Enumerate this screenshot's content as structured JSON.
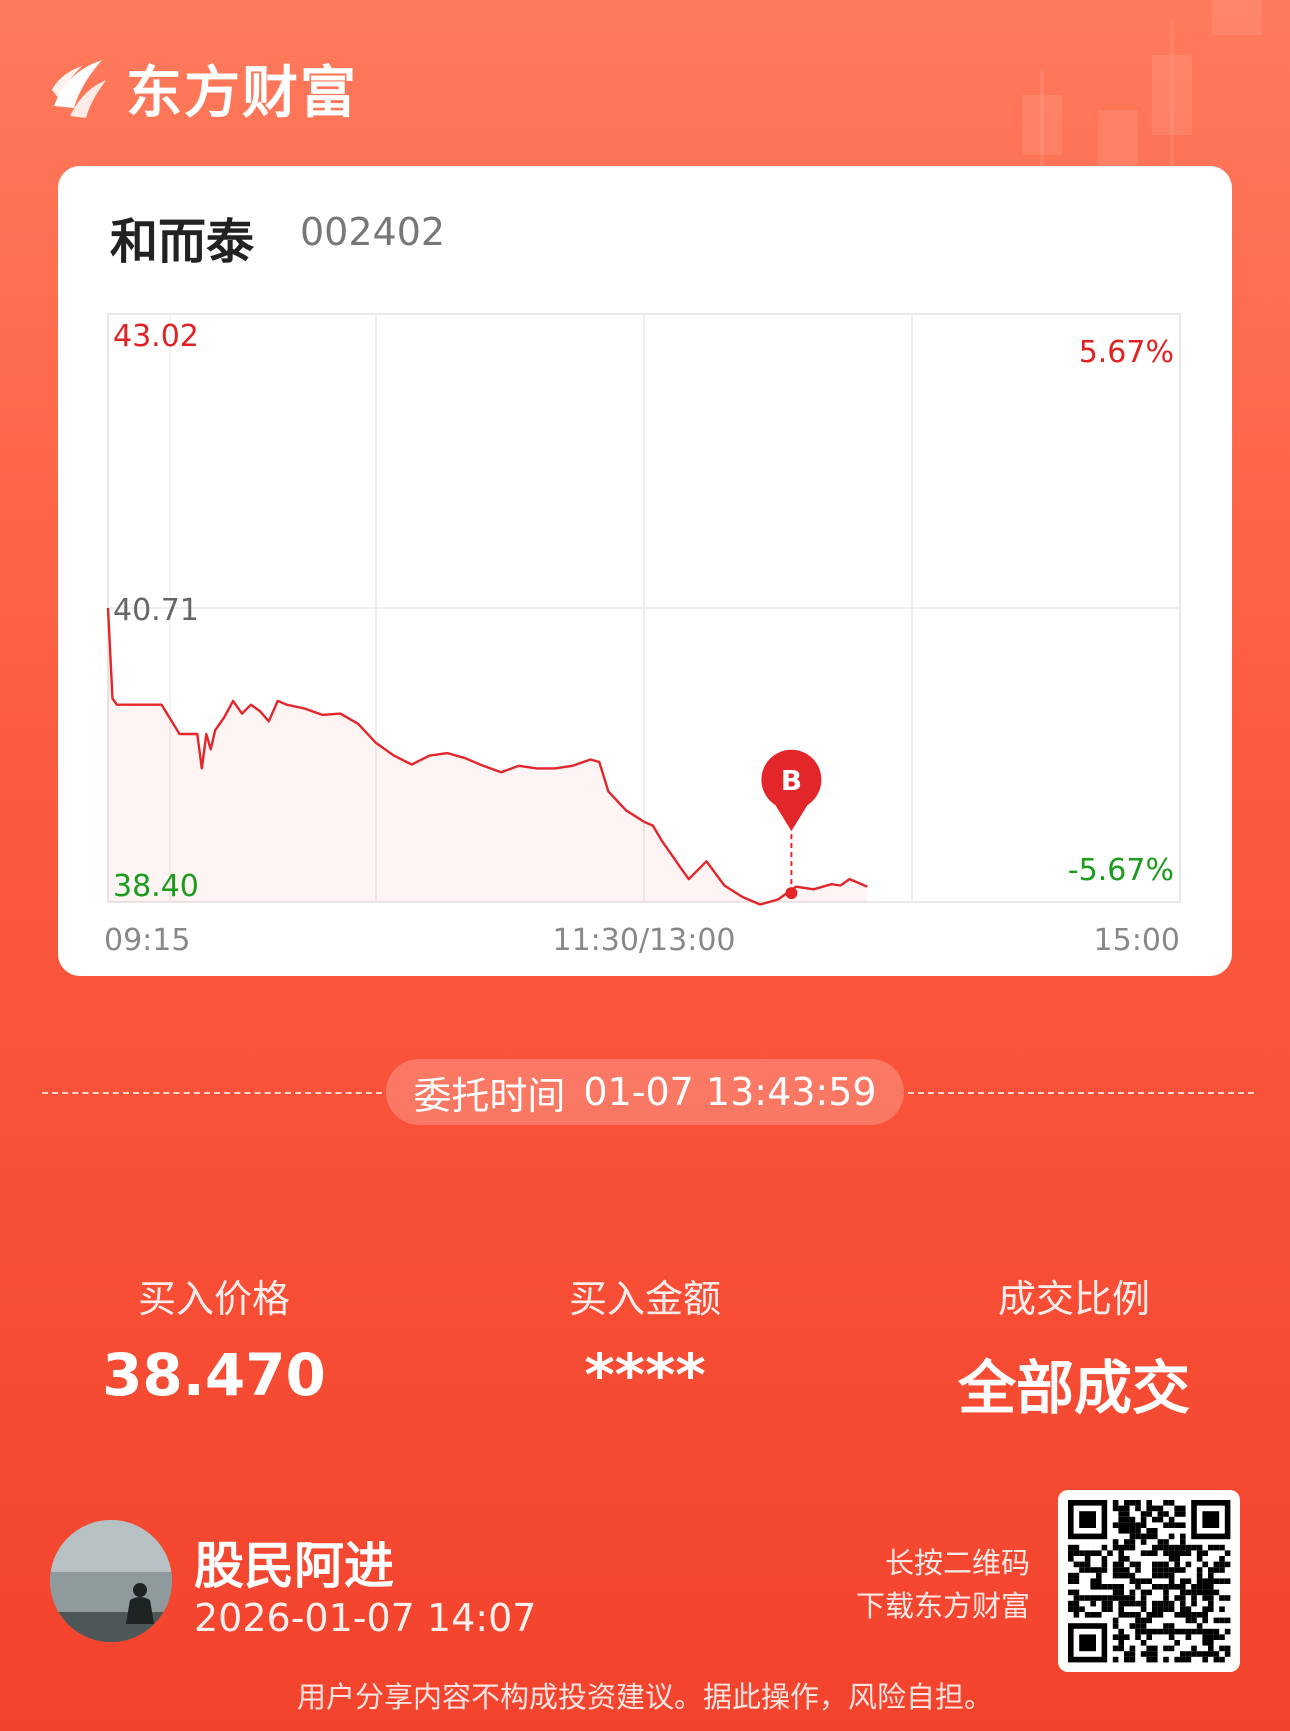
{
  "brand": {
    "name": "东方财富",
    "icon": "eastmoney-flame-logo-icon"
  },
  "stock": {
    "name": "和而泰",
    "code": "002402"
  },
  "chart_data": {
    "type": "line",
    "x_tick_labels": [
      "09:15",
      "11:30/13:00",
      "15:00"
    ],
    "y_left_labels": {
      "top": "43.02",
      "mid": "40.71",
      "bottom": "38.40"
    },
    "y_right_labels": {
      "top": "5.67%",
      "bottom": "-5.67%"
    },
    "ylim": [
      38.4,
      43.02
    ],
    "prev_close": 40.71,
    "x_unit": "trading minutes since 09:30 (session 0–240)",
    "x_minutes": [
      0,
      1,
      2,
      3,
      5,
      8,
      12,
      16,
      20,
      21,
      22,
      23,
      24,
      26,
      28,
      30,
      32,
      34,
      36,
      38,
      40,
      44,
      48,
      52,
      56,
      60,
      64,
      68,
      72,
      76,
      80,
      84,
      88,
      92,
      96,
      100,
      104,
      108,
      110,
      112,
      116,
      120,
      122,
      124,
      126,
      128,
      130,
      134,
      138,
      142,
      146,
      150,
      154,
      158,
      160,
      162,
      164,
      166,
      168,
      170,
      172,
      174,
      176,
      178,
      180,
      182,
      184,
      186,
      188,
      190,
      192,
      194,
      196,
      198,
      200
    ],
    "prices": [
      40.71,
      40.0,
      39.95,
      39.95,
      39.95,
      39.95,
      39.95,
      39.72,
      39.72,
      39.45,
      39.72,
      39.6,
      39.75,
      39.85,
      39.98,
      39.88,
      39.95,
      39.9,
      39.82,
      39.98,
      39.95,
      39.92,
      39.87,
      39.88,
      39.8,
      39.65,
      39.55,
      39.48,
      39.55,
      39.57,
      39.53,
      39.47,
      39.42,
      39.47,
      39.45,
      39.45,
      39.47,
      39.52,
      39.5,
      39.27,
      39.12,
      39.03,
      39.0,
      38.88,
      38.78,
      38.68,
      38.58,
      38.72,
      38.53,
      38.44,
      38.38,
      38.42,
      38.52,
      38.5,
      38.52,
      38.54,
      38.53,
      38.58,
      38.55,
      38.52
    ],
    "buy_marker": {
      "label": "B",
      "time_minutes": 153,
      "price": 38.47
    }
  },
  "order": {
    "time_label": "委托时间",
    "time_value": "01-07 13:43:59"
  },
  "stats": [
    {
      "label": "买入价格",
      "value": "38.470"
    },
    {
      "label": "买入金额",
      "value": "****"
    },
    {
      "label": "成交比例",
      "value": "全部成交"
    }
  ],
  "user": {
    "name": "股民阿进",
    "date": "2026-01-07 14:07",
    "avatar": "avatar-person-by-lake"
  },
  "qr": {
    "hint_line1": "长按二维码",
    "hint_line2": "下载东方财富",
    "icon": "qr-code-icon"
  },
  "disclaimer": "用户分享内容不构成投资建议。据此操作，风险自担。",
  "colors": {
    "up": "#e02222",
    "down": "#1c9c1c",
    "neutral": "#666666",
    "line": "#e3262a",
    "accent": "#f3432d"
  }
}
